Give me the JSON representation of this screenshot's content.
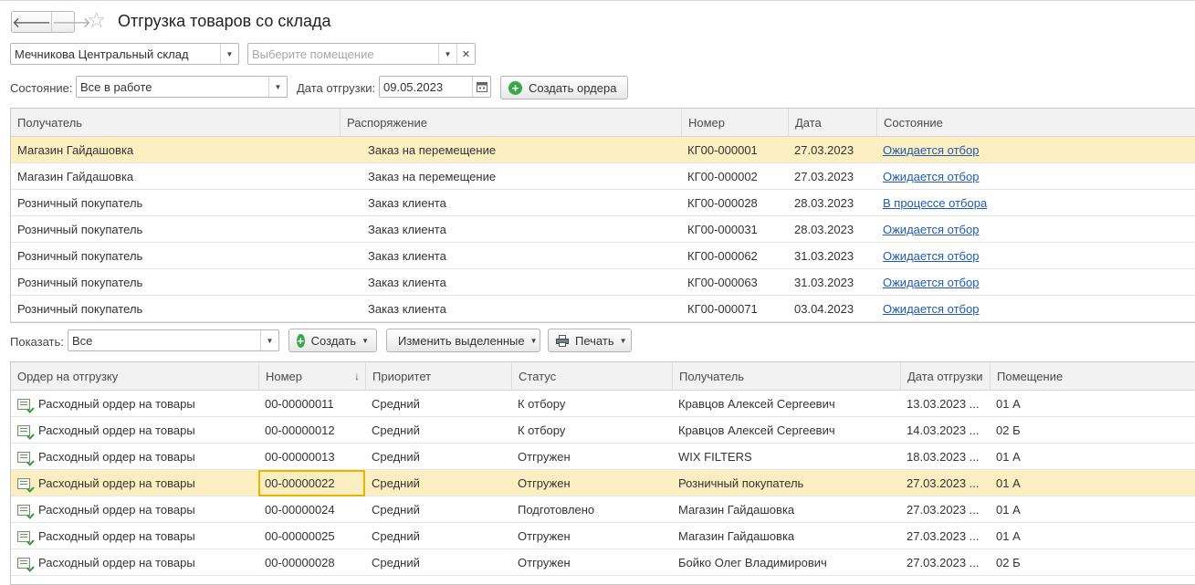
{
  "window": {
    "title": "Отгрузка товаров со склада"
  },
  "nav": {
    "back_glyph": "🡐",
    "forward_glyph": "🡒"
  },
  "filters": {
    "warehouse": "Мечникова Центральный склад",
    "room_placeholder": "Выберите помещение",
    "state_label": "Состояние:",
    "state_value": "Все в работе",
    "date_label": "Дата отгрузки:",
    "date_value": "09.05.2023",
    "create_orders_label": "Создать ордера"
  },
  "orders_table": {
    "columns": [
      "Получатель",
      "Распоряжение",
      "Номер",
      "Дата",
      "Состояние"
    ],
    "rows": [
      [
        "Магазин Гайдашовка",
        "Заказ на перемещение",
        "КГ00-000001",
        "27.03.2023",
        "Ожидается отбор"
      ],
      [
        "Магазин Гайдашовка",
        "Заказ на перемещение",
        "КГ00-000002",
        "27.03.2023",
        "Ожидается отбор"
      ],
      [
        "Розничный покупатель",
        "Заказ клиента",
        "КГ00-000028",
        "28.03.2023",
        "В процессе отбора"
      ],
      [
        "Розничный покупатель",
        "Заказ клиента",
        "КГ00-000031",
        "28.03.2023",
        "Ожидается отбор"
      ],
      [
        "Розничный покупатель",
        "Заказ клиента",
        "КГ00-000062",
        "31.03.2023",
        "Ожидается отбор"
      ],
      [
        "Розничный покупатель",
        "Заказ клиента",
        "КГ00-000063",
        "31.03.2023",
        "Ожидается отбор"
      ],
      [
        "Розничный покупатель",
        "Заказ клиента",
        "КГ00-000071",
        "03.04.2023",
        "Ожидается отбор"
      ]
    ]
  },
  "toolbar2": {
    "show_label": "Показать:",
    "show_value": "Все",
    "create_label": "Создать",
    "edit_selected_label": "Изменить выделенные",
    "print_label": "Печать"
  },
  "shipment_table": {
    "columns": [
      "Ордер на отгрузку",
      "Номер",
      "Приоритет",
      "Статус",
      "Получатель",
      "Дата отгрузки",
      "Помещение"
    ],
    "sort_glyph": "↓",
    "rows": [
      [
        "Расходный ордер на товары",
        "00-00000011",
        "Средний",
        "К отбору",
        "Кравцов Алексей Сергеевич",
        "13.03.2023 ...",
        "01 А"
      ],
      [
        "Расходный ордер на товары",
        "00-00000012",
        "Средний",
        "К отбору",
        "Кравцов Алексей Сергеевич",
        "14.03.2023 ...",
        "02 Б"
      ],
      [
        "Расходный ордер на товары",
        "00-00000013",
        "Средний",
        "Отгружен",
        " WIX FILTERS",
        "18.03.2023 ...",
        "01 А"
      ],
      [
        "Расходный ордер на товары",
        "00-00000022",
        "Средний",
        "Отгружен",
        "Розничный покупатель",
        "27.03.2023 ...",
        "01 А"
      ],
      [
        "Расходный ордер на товары",
        "00-00000024",
        "Средний",
        "Подготовлено",
        "Магазин Гайдашовка",
        "27.03.2023 ...",
        "01 А"
      ],
      [
        "Расходный ордер на товары",
        "00-00000025",
        "Средний",
        "Отгружен",
        "Магазин Гайдашовка",
        "27.03.2023 ...",
        "01 А"
      ],
      [
        "Расходный ордер на товары",
        "00-00000028",
        "Средний",
        "Отгружен",
        "Бойко Олег Владимирович",
        "27.03.2023 ...",
        "02 Б"
      ]
    ]
  },
  "colors": {
    "selected_row": "#fbeec0",
    "link": "#1f5bb5",
    "accent_green": "#3aa84a",
    "focus_border": "#e8b600"
  }
}
